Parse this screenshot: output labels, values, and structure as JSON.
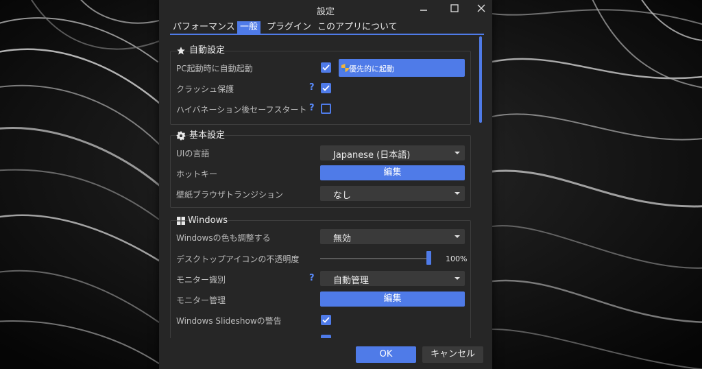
{
  "window": {
    "title": "設定",
    "controls": [
      "minimize-icon",
      "maximize-icon",
      "close-icon"
    ]
  },
  "tabs": [
    {
      "label": "パフォーマンス",
      "active": false
    },
    {
      "label": "一般",
      "active": true
    },
    {
      "label": "プラグイン",
      "active": false
    },
    {
      "label": "このアプリについて",
      "active": false
    }
  ],
  "auto_settings": {
    "title": "自動設定",
    "icon": "star-icon",
    "rows": [
      {
        "label": "PC起動時に自動起動",
        "checked": true,
        "help": ""
      },
      {
        "label": "クラッシュ保護",
        "checked": true,
        "help": "?"
      },
      {
        "label": "ハイバネーション後セーフスタート",
        "checked": false,
        "help": "?"
      }
    ],
    "priority_button": "優先的に起動",
    "priority_icon": "shield-icon"
  },
  "basic_settings": {
    "title": "基本設定",
    "icon": "gear-icon",
    "language_label": "UIの言語",
    "language_value": "Japanese (日本語)",
    "hotkey_label": "ホットキー",
    "hotkey_button": "編集",
    "transition_label": "壁紙ブラウザトランジション",
    "transition_value": "なし"
  },
  "windows_settings": {
    "title": "Windows",
    "icon": "windows-logo-icon",
    "color_label": "Windowsの色も調整する",
    "color_value": "無効",
    "opacity_label": "デスクトップアイコンの不透明度",
    "opacity_value": "100%",
    "opacity_level": 1.0,
    "monitor_id_label": "モニター識別",
    "monitor_id_help": "?",
    "monitor_id_value": "自動管理",
    "monitor_mgmt_label": "モニター管理",
    "monitor_mgmt_button": "編集",
    "slideshow_label": "Windows Slideshowの警告",
    "slideshow_checked": true
  },
  "footer": {
    "ok": "OK",
    "cancel": "キャンセル"
  },
  "colors": {
    "accent": "#4f7be8",
    "window_bg": "#262626",
    "select_bg": "#3a3a3a",
    "help": "#5a8cff"
  }
}
